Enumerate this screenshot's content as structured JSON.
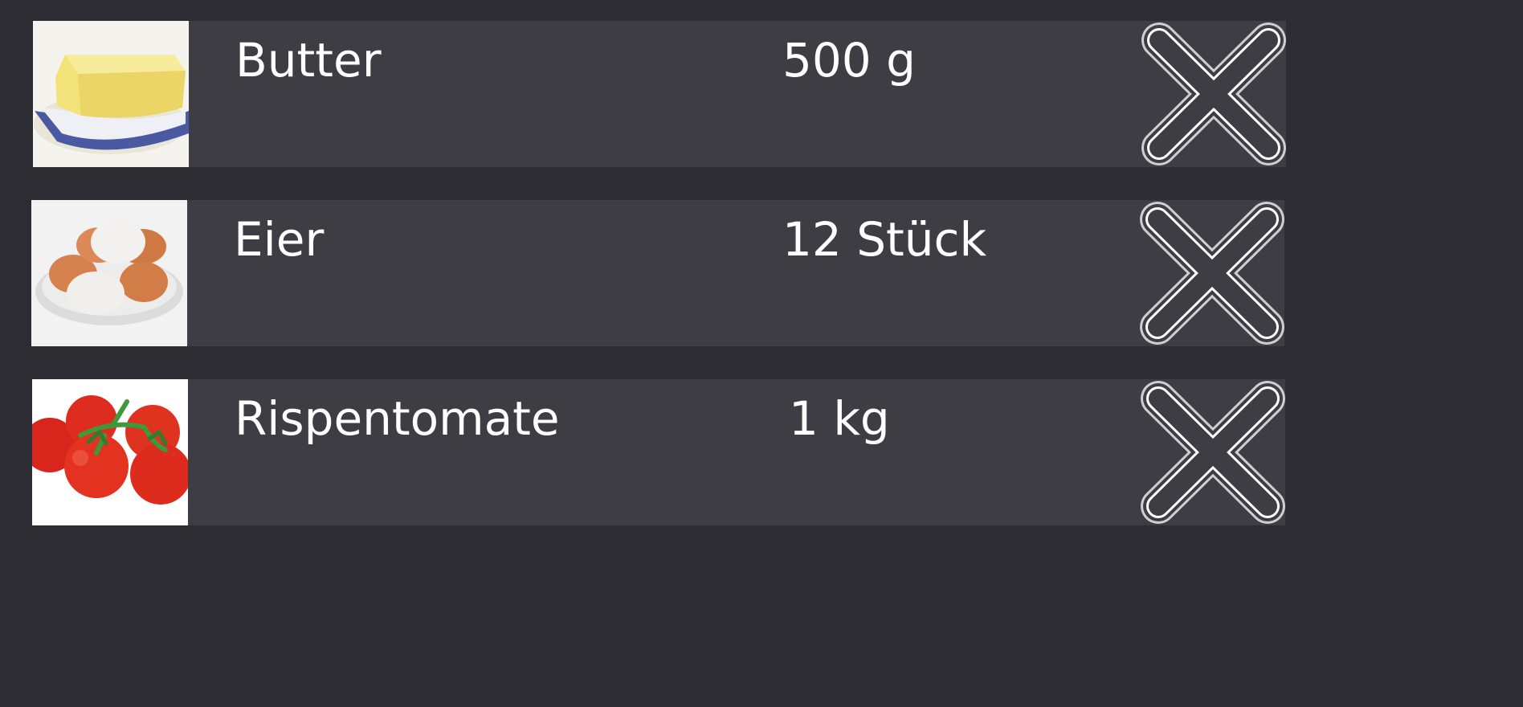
{
  "shopping_list": {
    "items": [
      {
        "name": "Butter",
        "quantity": "500 g",
        "image": "butter",
        "remove_icon": "close-icon"
      },
      {
        "name": "Eier",
        "quantity": "12 Stück",
        "image": "eggs",
        "remove_icon": "close-icon"
      },
      {
        "name": "Rispentomate",
        "quantity": "1 kg",
        "image": "tomatoes",
        "remove_icon": "close-icon"
      }
    ]
  },
  "colors": {
    "background": "#2d2c32",
    "row_background": "#3e3d44",
    "text": "#ffffff"
  }
}
